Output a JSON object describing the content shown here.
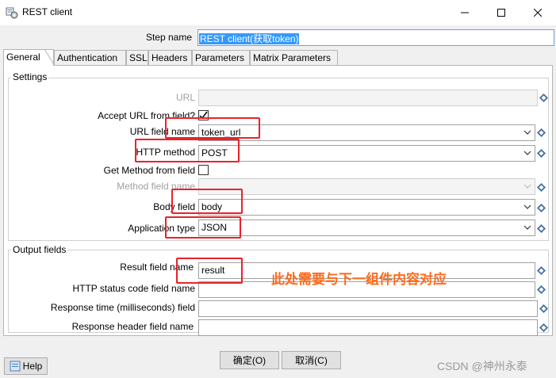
{
  "window": {
    "title": "REST client"
  },
  "step_name": {
    "label": "Step name",
    "value": "REST client(获取token)"
  },
  "tabs": [
    {
      "label": "General"
    },
    {
      "label": "Authentication"
    },
    {
      "label": "SSL"
    },
    {
      "label": "Headers"
    },
    {
      "label": "Parameters"
    },
    {
      "label": "Matrix Parameters"
    }
  ],
  "settings": {
    "title": "Settings",
    "url_label": "URL",
    "url_value": "",
    "accept_url_label": "Accept URL from field?",
    "accept_url_checked": true,
    "url_field_name_label": "URL field name",
    "url_field_name_value": "token_url",
    "http_method_label": "HTTP method",
    "http_method_value": "POST",
    "get_method_label": "Get Method from field",
    "get_method_checked": false,
    "method_field_name_label": "Method field name",
    "method_field_name_value": "",
    "body_field_label": "Body field",
    "body_field_value": "body",
    "application_type_label": "Application type",
    "application_type_value": "JSON"
  },
  "output": {
    "title": "Output fields",
    "result_label": "Result field name",
    "result_value": "result",
    "status_code_label": "HTTP status code field name",
    "status_code_value": "",
    "response_time_label": "Response time (milliseconds) field",
    "response_time_value": "",
    "response_header_label": "Response header field name",
    "response_header_value": ""
  },
  "annotation": "此处需要与下一组件内容对应",
  "buttons": {
    "ok": "确定(O)",
    "cancel": "取消(C)",
    "help": "Help"
  },
  "watermark": "CSDN @神州永泰"
}
